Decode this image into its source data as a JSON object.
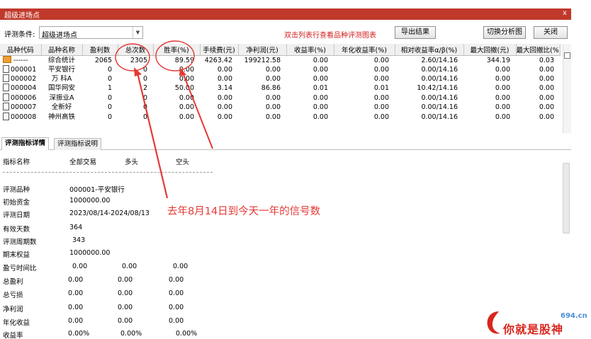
{
  "window": {
    "title": "超级进场点",
    "close": "x"
  },
  "toolbar": {
    "condition_label": "评测条件:",
    "condition_value": "超级进场点",
    "hint": "双击列表行查看品种评测图表",
    "export_button": "导出结果",
    "switch_button": "切换分析图",
    "close_button": "关闭"
  },
  "grid": {
    "columns": [
      "品种代码",
      "品种名称",
      "盈利数",
      "总次数",
      "胜率(%)",
      "手续费(元)",
      "净利润(元)",
      "收益率(%)",
      "年化收益率(%)",
      "相对收益率α/β(%)",
      "最大回撤(元)",
      "最大回撤比(%)"
    ],
    "rows": [
      [
        "------",
        "综合统计",
        "2065",
        "2305",
        "89.59",
        "4263.42",
        "199212.58",
        "0.00",
        "0.00",
        "2.60/14.16",
        "344.19",
        "0.03"
      ],
      [
        "000001",
        "平安银行",
        "0",
        "0",
        "0.00",
        "0.00",
        "0.00",
        "0.00",
        "0.00",
        "0.00/14.16",
        "0.00",
        "0.00"
      ],
      [
        "000002",
        "万 科A",
        "0",
        "0",
        "0.00",
        "0.00",
        "0.00",
        "0.00",
        "0.00",
        "0.00/14.16",
        "0.00",
        "0.00"
      ],
      [
        "000004",
        "国华网安",
        "1",
        "2",
        "50.00",
        "3.14",
        "86.86",
        "0.01",
        "0.01",
        "10.42/14.16",
        "0.00",
        "0.00"
      ],
      [
        "000006",
        "深振业A",
        "0",
        "0",
        "0.00",
        "0.00",
        "0.00",
        "0.00",
        "0.00",
        "0.00/14.16",
        "0.00",
        "0.00"
      ],
      [
        "000007",
        "全新好",
        "0",
        "0",
        "0.00",
        "0.00",
        "0.00",
        "0.00",
        "0.00",
        "0.00/14.16",
        "0.00",
        "0.00"
      ],
      [
        "000008",
        "神州高铁",
        "0",
        "0",
        "0.00",
        "0.00",
        "0.00",
        "0.00",
        "0.00",
        "0.00/14.16",
        "0.00",
        "0.00"
      ]
    ]
  },
  "tabs": [
    "评测指标详情",
    "评测指标说明"
  ],
  "details": {
    "headers": [
      "指标名称",
      "全部交易",
      "多头",
      "空头"
    ],
    "rows": [
      {
        "label": "评测品种",
        "values": [
          "000001-平安银行"
        ]
      },
      {
        "label": "初始资金",
        "values": [
          "1000000.00"
        ]
      },
      {
        "label": "评测日期",
        "values": [
          "2023/08/14-2024/08/13"
        ]
      },
      {
        "label": "有效天数",
        "values": [
          "364"
        ]
      },
      {
        "label": "评测周期数",
        "values": [
          "343"
        ]
      },
      {
        "label": "期末权益",
        "values": [
          "1000000.00"
        ]
      },
      {
        "label": "盈亏时间比",
        "values": [
          "0.00",
          "0.00",
          "0.00"
        ]
      },
      {
        "label": "总盈利",
        "values": [
          "0.00",
          "0.00",
          "0.00"
        ]
      },
      {
        "label": "总亏损",
        "values": [
          "0.00",
          "0.00",
          "0.00"
        ]
      },
      {
        "label": "净利润",
        "values": [
          "0.00",
          "0.00",
          "0.00"
        ]
      },
      {
        "label": "年化收益",
        "values": [
          "0.00",
          "0.00",
          "0.00"
        ]
      },
      {
        "label": "收益率",
        "values": [
          "0.00%",
          "0.00%",
          "0.00%"
        ]
      }
    ]
  },
  "annotation": "去年8月14日到今天一年的信号数",
  "watermark": {
    "domain": "694.cn",
    "text": "你就是股神"
  },
  "colors": {
    "titlebar": "#c0392b",
    "hint": "#d11e1e",
    "annotation": "#e53935"
  }
}
